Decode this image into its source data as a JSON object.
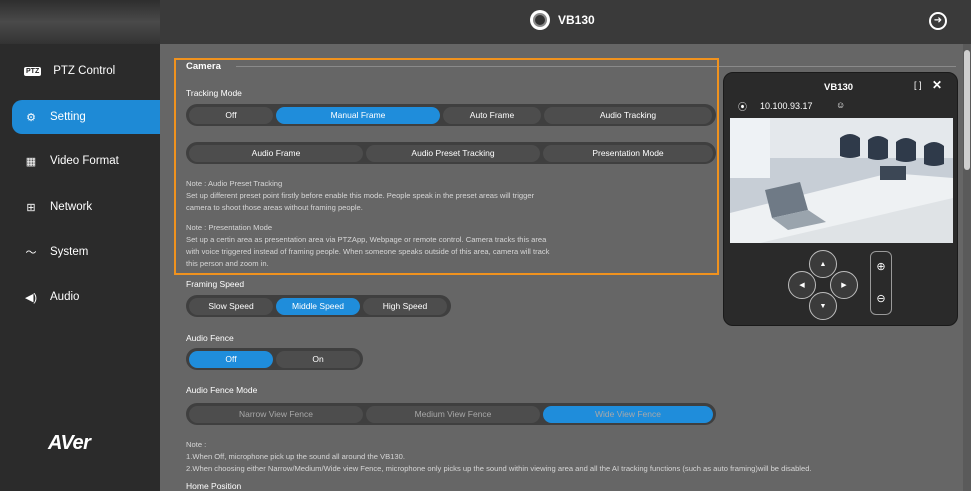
{
  "header": {
    "title": "VB130"
  },
  "sidebar": {
    "items": [
      {
        "label": "PTZ Control",
        "icon": "ptz-icon",
        "icon_text": "PTZ"
      },
      {
        "label": "Setting",
        "icon": "gear-icon"
      },
      {
        "label": "Video Format",
        "icon": "film-icon"
      },
      {
        "label": "Network",
        "icon": "network-icon"
      },
      {
        "label": "System",
        "icon": "pulse-icon"
      },
      {
        "label": "Audio",
        "icon": "speaker-icon"
      }
    ],
    "active_index": 1,
    "logo": "AVer"
  },
  "camera": {
    "title": "Camera",
    "tracking_mode": {
      "label": "Tracking Mode",
      "row1": [
        "Off",
        "Manual Frame",
        "Auto Frame",
        "Audio Tracking"
      ],
      "row2": [
        "Audio Frame",
        "Audio Preset Tracking",
        "Presentation Mode"
      ],
      "selected": "Manual Frame"
    },
    "note1": {
      "title": "Note : Audio Preset Tracking",
      "line1": "Set up different preset point firstly before enable this mode. People speak in the preset areas will trigger",
      "line2": "camera to shoot those areas without framing people."
    },
    "note2": {
      "title": "Note : Presentation Mode",
      "line1": "Set up a certin area as presentation area via PTZApp, Webpage or remote control. Camera tracks this area",
      "line2": "with voice triggered instead of framing people. When someone speaks outside of this area, camera will track",
      "line3": "this person and zoom in."
    },
    "framing_speed": {
      "label": "Framing Speed",
      "options": [
        "Slow Speed",
        "Middle Speed",
        "High Speed"
      ],
      "selected": "Middle Speed"
    },
    "audio_fence": {
      "label": "Audio Fence",
      "options": [
        "Off",
        "On"
      ],
      "selected": "Off"
    },
    "audio_fence_mode": {
      "label": "Audio Fence Mode",
      "options": [
        "Narrow View Fence",
        "Medium View Fence",
        "Wide View Fence"
      ],
      "selected": "Wide View Fence"
    },
    "note3": {
      "title": "Note :",
      "line1": "1.When Off, microphone pick up the sound all around the VB130.",
      "line2": "2.When choosing either Narrow/Medium/Wide view Fence, microphone only picks up the sound within viewing area and all the AI tracking functions (such as auto framing)will be disabled."
    },
    "home_position": {
      "label": "Home Position"
    }
  },
  "ptz_panel": {
    "title": "VB130",
    "ip": "10.100.93.17",
    "expand": "[ ]",
    "close": "✕"
  },
  "colors": {
    "accent": "#1f8ddb",
    "highlight": "#f0921e",
    "sidebar_bg": "#2b2b2b",
    "content_bg": "#666666"
  }
}
